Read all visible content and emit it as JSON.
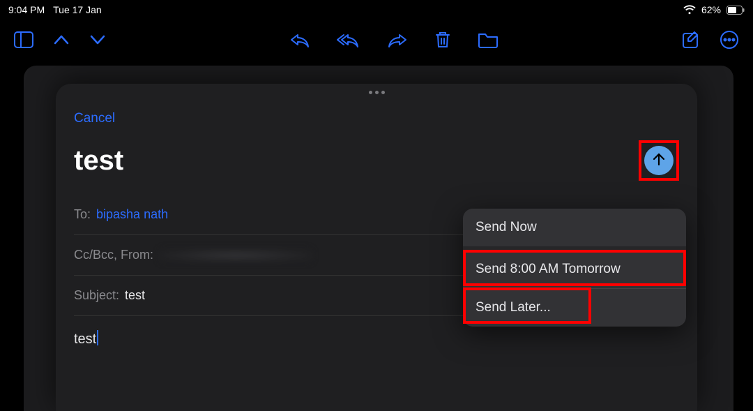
{
  "status": {
    "time": "9:04 PM",
    "date": "Tue 17 Jan",
    "battery_pct": "62%"
  },
  "toolbar": {
    "accent": "#2c6cff"
  },
  "compose": {
    "cancel_label": "Cancel",
    "title": "test",
    "to_label": "To:",
    "to_value": "bipasha nath",
    "ccbcc_label": "Cc/Bcc, From:",
    "subject_label": "Subject:",
    "subject_value": "test",
    "body_text": "test"
  },
  "send_menu": {
    "send_now": "Send Now",
    "send_tomorrow": "Send 8:00 AM Tomorrow",
    "send_later": "Send Later..."
  }
}
